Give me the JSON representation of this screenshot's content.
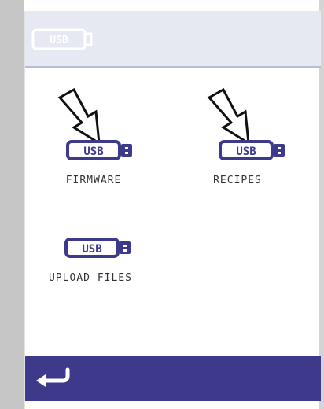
{
  "header": {
    "usb_icon_text": "USB"
  },
  "tiles": [
    {
      "id": "firmware",
      "label": "FIRMWARE",
      "icon_text": "USB",
      "has_arrow": true
    },
    {
      "id": "recipes",
      "label": "RECIPES",
      "icon_text": "USB",
      "has_arrow": true
    },
    {
      "id": "upload",
      "label": "UPLOAD FILES",
      "icon_text": "USB",
      "has_arrow": false
    }
  ],
  "footer": {
    "back_icon": "return-arrow-icon"
  },
  "colors": {
    "accent": "#3d3a8c",
    "header_bg": "#e6e8f2",
    "bezel": "#c6c6c6"
  }
}
